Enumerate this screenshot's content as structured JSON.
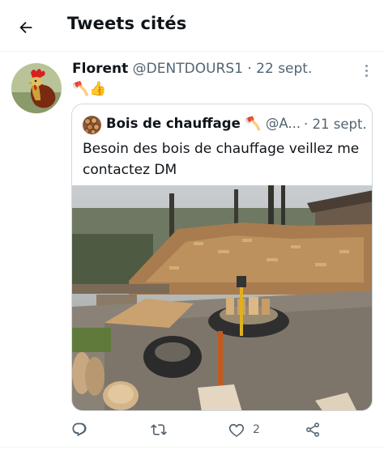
{
  "header": {
    "title": "Tweets cités",
    "back_icon": "arrow-left-icon"
  },
  "tweet": {
    "author_name": "Florent",
    "author_handle": "@DENTDOURS1",
    "separator": "·",
    "date": "22 sept.",
    "text": "🪓👍",
    "quoted": {
      "author_name": "Bois de chauffage",
      "name_emoji": "🪓",
      "author_handle": "@A...",
      "separator": "·",
      "date": "21 sept.",
      "text": "Besoin des bois de chauffage veillez me contactez DM"
    },
    "actions": {
      "reply_icon": "reply-icon",
      "retweet_icon": "retweet-icon",
      "like_icon": "heart-icon",
      "like_count": "2",
      "share_icon": "share-icon"
    }
  },
  "colors": {
    "text": "#0f1419",
    "secondary": "#536471",
    "border": "#cfd9de",
    "divider": "#eff3f4"
  }
}
